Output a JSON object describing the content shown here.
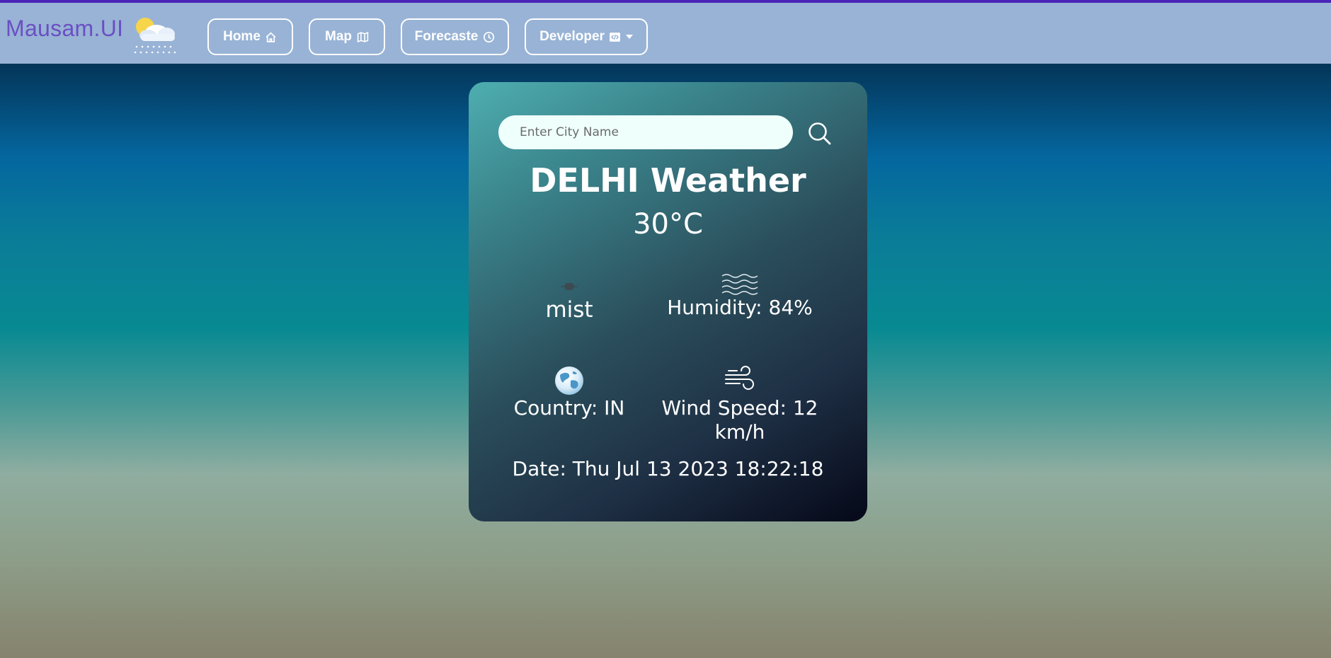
{
  "brand": {
    "name": "Mausam.UI",
    "logo_icon": "sun-cloud-rain-icon"
  },
  "nav": {
    "home": {
      "label": "Home",
      "icon": "home-icon"
    },
    "map": {
      "label": "Map",
      "icon": "map-icon"
    },
    "forecast": {
      "label": "Forecaste",
      "icon": "clock-icon"
    },
    "developer": {
      "label": "Developer",
      "icon": "code-icon"
    }
  },
  "search": {
    "placeholder": "Enter City Name",
    "value": ""
  },
  "weather": {
    "title": "DELHI Weather",
    "temperature": "30°C",
    "description": "mist",
    "humidity": "Humidity: 84%",
    "country": "Country: IN",
    "wind": "Wind Speed: 12 km/h",
    "date": "Date: Thu Jul 13 2023 18:22:18"
  },
  "colors": {
    "accent_border": "#4a24b8",
    "navbar_bg": "#98b3d5",
    "brand_text": "#6b4fc4"
  }
}
